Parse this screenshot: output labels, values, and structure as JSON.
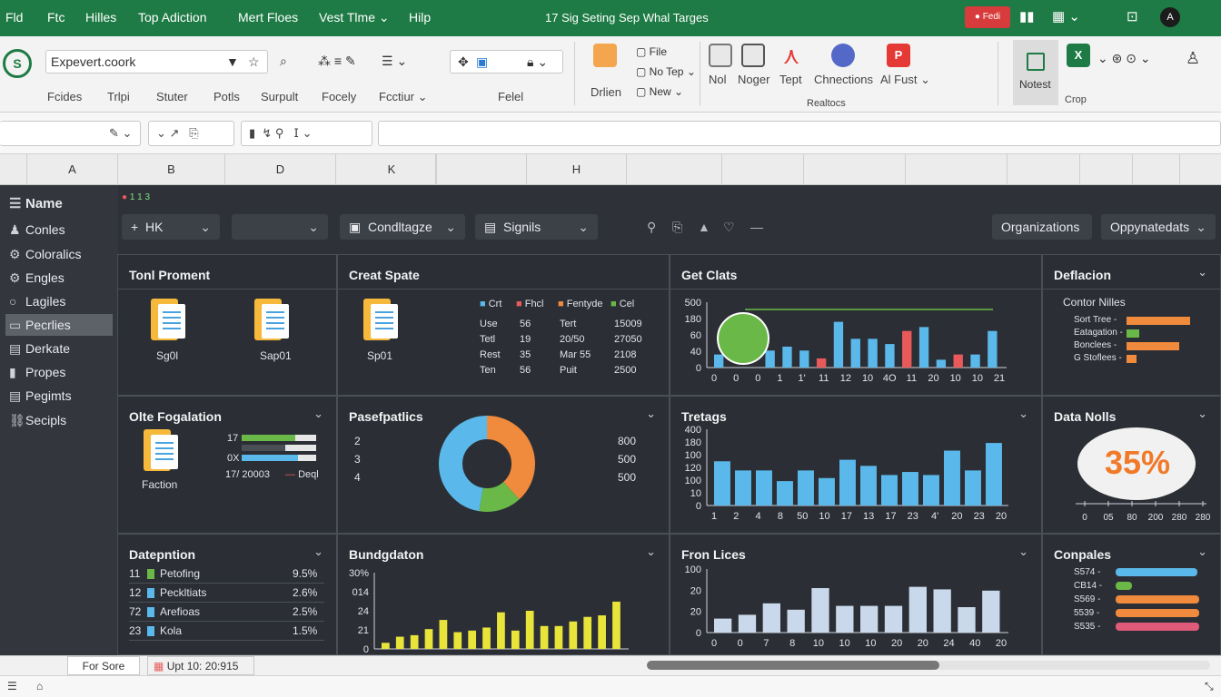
{
  "menu": {
    "items": [
      "Fld",
      "Ftc",
      "Hilles",
      "Top Adiction",
      "Mert Floes",
      "Vest Tlme",
      "Hilp"
    ],
    "title": "17 Sig Seting Sep Whal Targes",
    "rec": "Fedi"
  },
  "ribbon": {
    "namebox": "Expevert.coork",
    "labels": [
      "Fcides",
      "Trlpi",
      "Stuter",
      "Potls",
      "Surpult",
      "Focely",
      "Fcctiur"
    ],
    "center_label": "Felel",
    "drlien": "Drlien",
    "items": {
      "file": "File",
      "notep": "No Tep",
      "new": "New"
    },
    "big": [
      "Nol",
      "Noger",
      "Tept",
      "Chnections",
      "Al Fust"
    ],
    "group": "Realtocs",
    "notes": "Notest",
    "crop": "Crop"
  },
  "columns": [
    "A",
    "B",
    "D",
    "K",
    "H"
  ],
  "sidebar": {
    "items": [
      "Name",
      "Conles",
      "Coloralics",
      "Engles",
      "Lagiles",
      "Pecrlies",
      "Derkate",
      "Propes",
      "Pegimts",
      "Secipls"
    ]
  },
  "toolbar": {
    "small": "1 1 3",
    "dd1": "HK",
    "dd3": "Condltagze",
    "dd4": "Signils",
    "org": "Organizations",
    "opp": "Oppynatedats"
  },
  "panels": {
    "p1": {
      "title": "Tonl Proment",
      "file1": "Sg0l",
      "file2": "Sap01"
    },
    "p2": {
      "title": "Creat Spate",
      "file": "Sp01",
      "legend": [
        "Crt",
        "Fhcl",
        "Fentyde",
        "Cel"
      ],
      "rows": [
        [
          "Use",
          "56",
          "Tert",
          "15009"
        ],
        [
          "Tetl",
          "19",
          "20/50",
          "27050"
        ],
        [
          "Rest",
          "35",
          "Mar 55",
          "2108"
        ],
        [
          "Ten",
          "56",
          "Puit",
          "2500"
        ]
      ]
    },
    "p3": {
      "title": "Get Clats"
    },
    "p4": {
      "title": "Deflacion",
      "sub": "Contor Nilles",
      "items": [
        "Sort Tree",
        "Eatagation",
        "Bonclees",
        "G Stoflees"
      ]
    },
    "p5": {
      "title": "Olte Fogalation",
      "file": "Faction",
      "l1": "17",
      "l2": "0X",
      "foot": "17/ 20003",
      "foot2": "Deql"
    },
    "p6": {
      "title": "Pasefpatlics",
      "left": [
        "2",
        "3",
        "4"
      ],
      "right": [
        "800",
        "500",
        "500"
      ]
    },
    "p7": {
      "title": "Tretags"
    },
    "p8": {
      "title": "Data Nolls",
      "value": "35%"
    },
    "p9": {
      "title": "Datepntion",
      "rows": [
        [
          "11",
          "Petofing",
          "9.5%"
        ],
        [
          "12",
          "Peckltiats",
          "2.6%"
        ],
        [
          "72",
          "Arefioas",
          "2.5%"
        ],
        [
          "23",
          "Kola",
          "1.5%"
        ]
      ]
    },
    "p10": {
      "title": "Bundgdaton"
    },
    "p11": {
      "title": "Fron Lices"
    },
    "p12": {
      "title": "Conpales",
      "items": [
        "S574",
        "CB14",
        "S569",
        "5539",
        "S535"
      ]
    }
  },
  "status": {
    "tab1": "For Sore",
    "tab2": "Upt 10: 20:915"
  },
  "colors": {
    "green": "#1e7b45",
    "blue": "#5bb8ea",
    "orange": "#f08a3c",
    "yellow": "#e8e43a",
    "red": "#e85a5a",
    "lime": "#6ab847"
  },
  "charts": {
    "c1": {
      "x": [
        "0",
        "0",
        "0",
        "1",
        "1'",
        "11",
        "12",
        "10",
        "4O",
        "11",
        "20",
        "10",
        "10",
        "21"
      ],
      "y": [
        "500",
        "180",
        "60",
        "40",
        "0"
      ],
      "values": [
        20,
        0,
        0,
        26,
        32,
        26,
        14,
        70,
        44,
        44,
        36,
        56,
        62,
        12,
        20,
        20,
        56
      ],
      "redIdx": [
        6,
        11,
        14
      ]
    },
    "c2": {
      "x": [
        "1",
        "2",
        "4",
        "8",
        "50",
        "10",
        "17",
        "13",
        "17",
        "23",
        "4'",
        "20",
        "23",
        "20"
      ],
      "y": [
        "400",
        "180",
        "100",
        "120",
        "100",
        "10",
        "0"
      ],
      "values": [
        58,
        46,
        46,
        32,
        46,
        36,
        60,
        52,
        40,
        44,
        40,
        72,
        46,
        82
      ]
    },
    "c3": {
      "x": [
        "0",
        "0",
        "7",
        "8",
        "10",
        "10",
        "10",
        "20",
        "20",
        "24",
        "40",
        "20"
      ],
      "y": [
        "100",
        "20",
        "20",
        "0"
      ],
      "values": [
        22,
        28,
        46,
        36,
        70,
        42,
        42,
        42,
        72,
        68,
        40,
        66
      ]
    },
    "c4": {
      "y": [
        "30%",
        "014",
        "24",
        "21",
        "0"
      ],
      "values": [
        8,
        16,
        18,
        26,
        38,
        22,
        24,
        28,
        48,
        24,
        50,
        30,
        30,
        36,
        42,
        44,
        62
      ]
    },
    "c5": {
      "x": [
        "0",
        "05",
        "80",
        "200",
        "280",
        "280"
      ]
    },
    "bars": {
      "def": [
        88,
        18,
        72,
        14
      ],
      "comp": [
        90,
        18,
        92,
        92,
        92
      ]
    }
  }
}
